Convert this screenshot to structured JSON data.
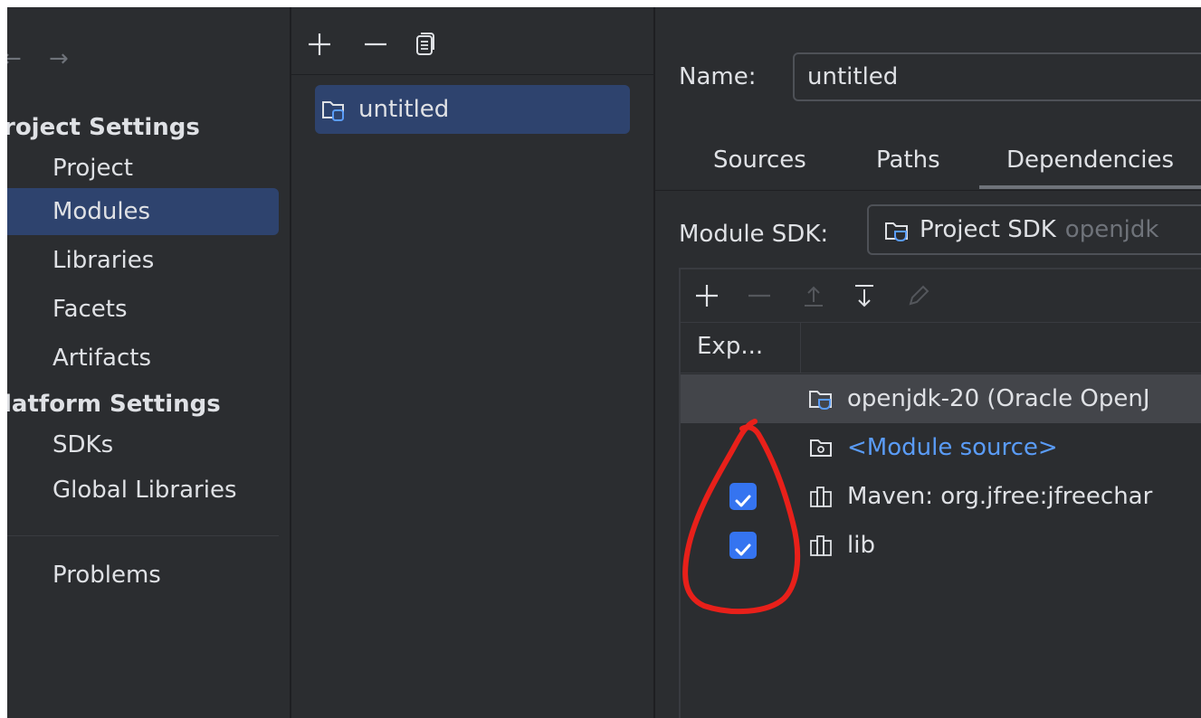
{
  "nav": {
    "back_arrow": "←",
    "forward_arrow": "→",
    "project_settings_header": "roject Settings",
    "project_items": [
      "Project",
      "Modules",
      "Libraries",
      "Facets",
      "Artifacts"
    ],
    "platform_settings_header": "latform Settings",
    "platform_items": [
      "SDKs",
      "Global Libraries"
    ],
    "problems": "Problems",
    "selected_item": "Modules"
  },
  "module_list": {
    "toolbar_icons": [
      "add-icon",
      "remove-icon",
      "copy-icon"
    ],
    "modules": [
      {
        "name": "untitled",
        "icon": "module-folder-icon",
        "selected": true
      }
    ]
  },
  "detail": {
    "name_label": "Name:",
    "name_value": "untitled",
    "tabs": [
      "Sources",
      "Paths",
      "Dependencies"
    ],
    "active_tab": "Dependencies",
    "module_sdk_label": "Module SDK:",
    "module_sdk_value": "Project SDK",
    "module_sdk_detail": "openjdk",
    "deps_toolbar_icons": [
      "add-icon",
      "remove-icon",
      "move-up-icon",
      "move-down-icon",
      "edit-icon"
    ],
    "export_column_header": "Exp...",
    "dependencies": [
      {
        "label": "openjdk-20 (Oracle OpenJ",
        "icon": "jdk-folder-icon",
        "checked": null,
        "highlighted": true,
        "link": false
      },
      {
        "label": "<Module source>",
        "icon": "module-source-icon",
        "checked": null,
        "highlighted": false,
        "link": true
      },
      {
        "label": "Maven: org.jfree:jfreechar",
        "icon": "library-icon",
        "checked": true,
        "highlighted": false,
        "link": false
      },
      {
        "label": "lib",
        "icon": "library-icon",
        "checked": true,
        "highlighted": false,
        "link": false
      }
    ]
  },
  "colors": {
    "background": "#2b2d30",
    "selection": "#2e436e",
    "checkbox": "#3574f0",
    "link": "#5a9cf8",
    "annotation": "#e8201a"
  }
}
